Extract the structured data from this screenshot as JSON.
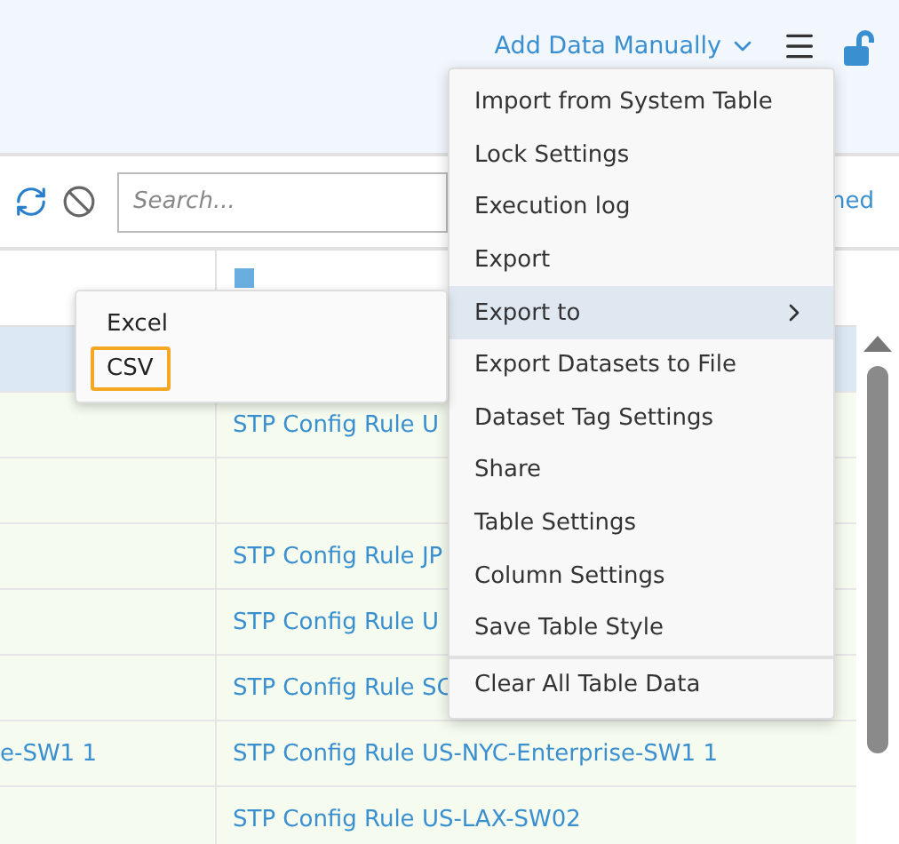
{
  "header": {
    "add_data_button": "Add Data Manually"
  },
  "toolbar": {
    "search": {
      "placeholder": "Search..."
    },
    "trailing_text": "ned"
  },
  "table": {
    "rows": [
      {
        "selected": true,
        "cells": [
          "",
          ""
        ]
      },
      {
        "selected": false,
        "cells": [
          "",
          "STP Config Rule U"
        ]
      },
      {
        "selected": false,
        "cells": [
          "",
          ""
        ]
      },
      {
        "selected": false,
        "cells": [
          "",
          "STP Config Rule JP"
        ]
      },
      {
        "selected": false,
        "cells": [
          "",
          "STP Config Rule U"
        ]
      },
      {
        "selected": false,
        "cells": [
          "",
          "STP Config Rule SC"
        ]
      },
      {
        "selected": false,
        "cells": [
          "e-SW1 1",
          "STP Config Rule US-NYC-Enterprise-SW1 1"
        ]
      },
      {
        "selected": false,
        "cells": [
          "",
          "STP Config Rule US-LAX-SW02"
        ]
      }
    ]
  },
  "menu": {
    "items": [
      {
        "label": "Import from System Table",
        "selected": false,
        "submenu": false,
        "separated": false
      },
      {
        "label": "Lock Settings",
        "selected": false,
        "submenu": false,
        "separated": false
      },
      {
        "label": "Execution log",
        "selected": false,
        "submenu": false,
        "separated": false
      },
      {
        "label": "Export",
        "selected": false,
        "submenu": false,
        "separated": false
      },
      {
        "label": "Export to",
        "selected": true,
        "submenu": true,
        "separated": false
      },
      {
        "label": "Export Datasets to File",
        "selected": false,
        "submenu": false,
        "separated": false
      },
      {
        "label": "Dataset Tag Settings",
        "selected": false,
        "submenu": false,
        "separated": false
      },
      {
        "label": "Share",
        "selected": false,
        "submenu": false,
        "separated": false
      },
      {
        "label": "Table Settings",
        "selected": false,
        "submenu": false,
        "separated": false
      },
      {
        "label": "Column Settings",
        "selected": false,
        "submenu": false,
        "separated": false
      },
      {
        "label": "Save Table Style",
        "selected": false,
        "submenu": false,
        "separated": false
      },
      {
        "label": "Clear All Table Data",
        "selected": false,
        "submenu": false,
        "separated": true
      }
    ]
  },
  "submenu": {
    "items": [
      {
        "label": "Excel",
        "selected": false
      },
      {
        "label": "CSV",
        "selected": true
      }
    ]
  }
}
